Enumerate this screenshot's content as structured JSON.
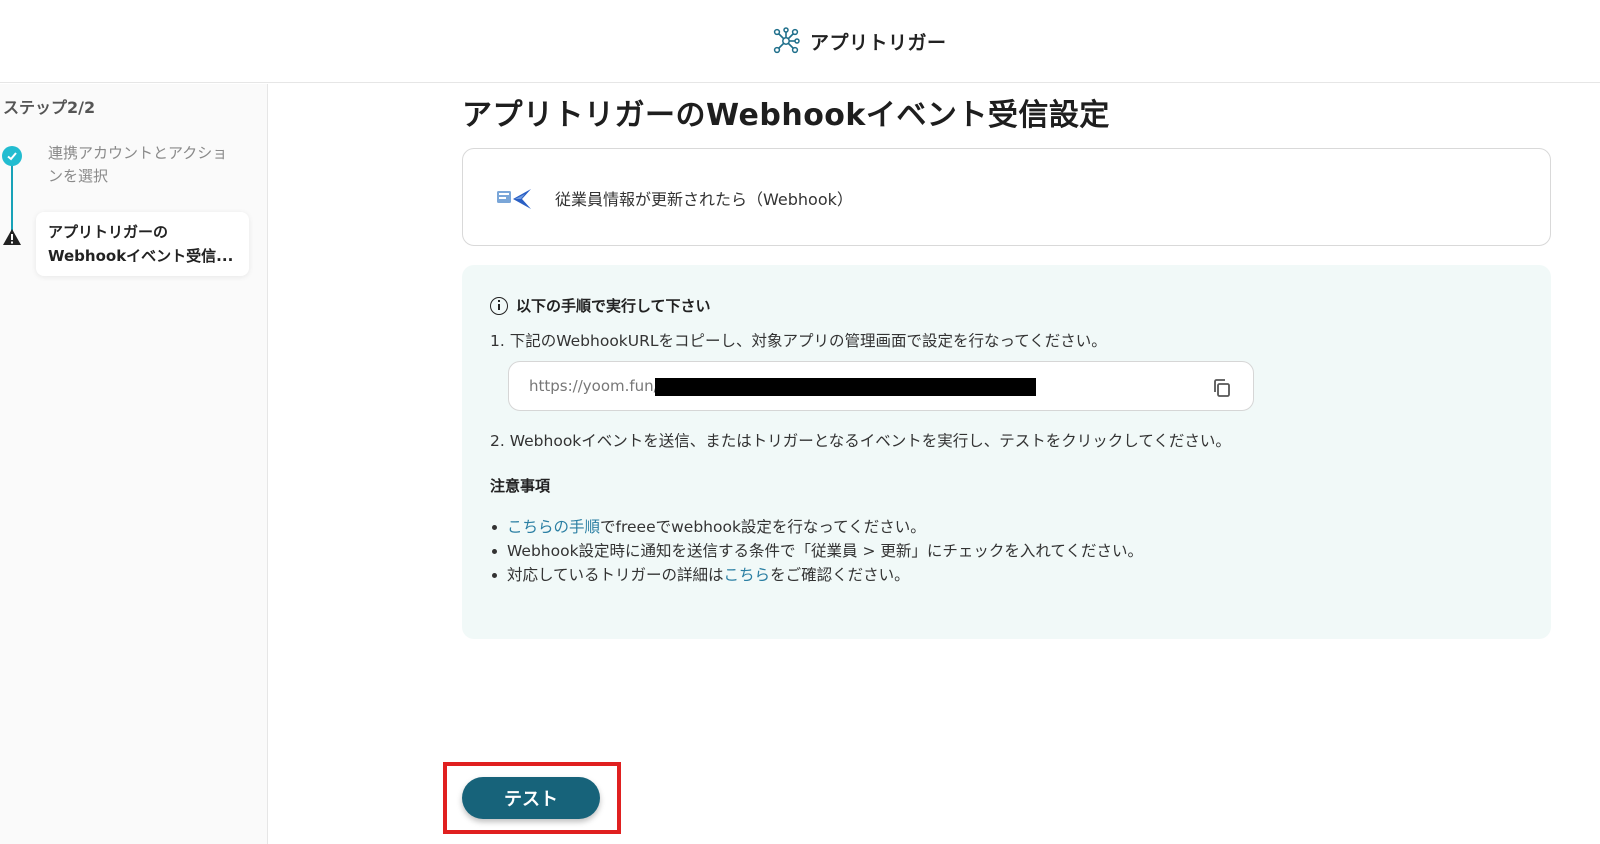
{
  "header": {
    "title": "アプリトリガー",
    "icon": "network-nodes-icon"
  },
  "sidebar": {
    "step_heading": "ステップ2/2",
    "steps": [
      {
        "label": "連携アカウントとアクションを選択",
        "status": "complete",
        "icon": "check-circle-icon"
      },
      {
        "label_line1": "アプリトリガーの",
        "label_line2": "Webhookイベント受信...",
        "status": "warning",
        "icon": "warning-triangle-icon"
      }
    ]
  },
  "main": {
    "title": "アプリトリガーのWebhookイベント受信設定",
    "trigger": {
      "label": "従業員情報が更新されたら（Webhook）",
      "icon": "freee-app-icon"
    },
    "info": {
      "title": "以下の手順で実行して下さい",
      "instruction1": "1. 下記のWebhookURLをコピーし、対象アプリの管理画面で設定を行なってください。",
      "url_prefix": "https://yoom.fun/",
      "instruction2": "2. Webhookイベントを送信、またはトリガーとなるイベントを実行し、テストをクリックしてください。",
      "notes_title": "注意事項",
      "notes": [
        {
          "link": "こちらの手順",
          "text": "でfreeeでwebhook設定を行なってください。"
        },
        {
          "text": "Webhook設定時に通知を送信する条件で「従業員 > 更新」にチェックを入れてください。"
        },
        {
          "pre": "対応しているトリガーの詳細は",
          "link": "こちら",
          "post": "をご確認ください。"
        }
      ]
    },
    "test_button": "テスト"
  },
  "colors": {
    "accent": "#17637a",
    "check": "#22bcd0",
    "info_bg": "#f1f9f8",
    "link": "#2b7fa3",
    "highlight": "#e02020"
  }
}
